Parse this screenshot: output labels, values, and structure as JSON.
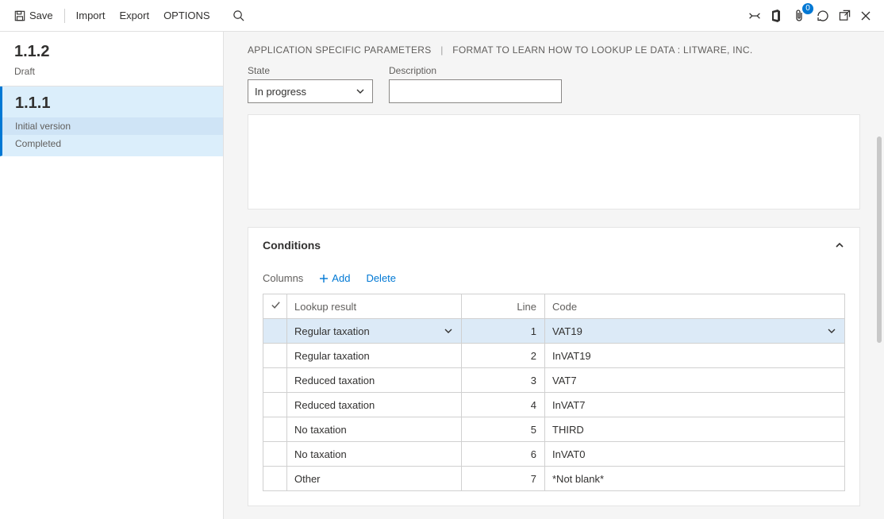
{
  "toolbar": {
    "save": "Save",
    "import": "Import",
    "export": "Export",
    "options": "OPTIONS",
    "badge_count": "0"
  },
  "versions": [
    {
      "number": "1.1.2",
      "status": "Draft",
      "selected": false
    },
    {
      "number": "1.1.1",
      "meta1": "Initial version",
      "meta2": "Completed",
      "selected": true
    }
  ],
  "breadcrumb": {
    "a": "APPLICATION SPECIFIC PARAMETERS",
    "b": "FORMAT TO LEARN HOW TO LOOKUP LE DATA : LITWARE, INC."
  },
  "fields": {
    "state_label": "State",
    "state_value": "In progress",
    "desc_label": "Description",
    "desc_value": ""
  },
  "conditions": {
    "title": "Conditions",
    "columns_label": "Columns",
    "add_label": "Add",
    "delete_label": "Delete",
    "headers": {
      "lookup": "Lookup result",
      "line": "Line",
      "code": "Code"
    },
    "rows": [
      {
        "lookup": "Regular taxation",
        "line": "1",
        "code": "VAT19",
        "selected": true
      },
      {
        "lookup": "Regular taxation",
        "line": "2",
        "code": "InVAT19"
      },
      {
        "lookup": "Reduced taxation",
        "line": "3",
        "code": "VAT7"
      },
      {
        "lookup": "Reduced taxation",
        "line": "4",
        "code": "InVAT7"
      },
      {
        "lookup": "No taxation",
        "line": "5",
        "code": "THIRD"
      },
      {
        "lookup": "No taxation",
        "line": "6",
        "code": "InVAT0"
      },
      {
        "lookup": "Other",
        "line": "7",
        "code": "*Not blank*"
      }
    ]
  }
}
